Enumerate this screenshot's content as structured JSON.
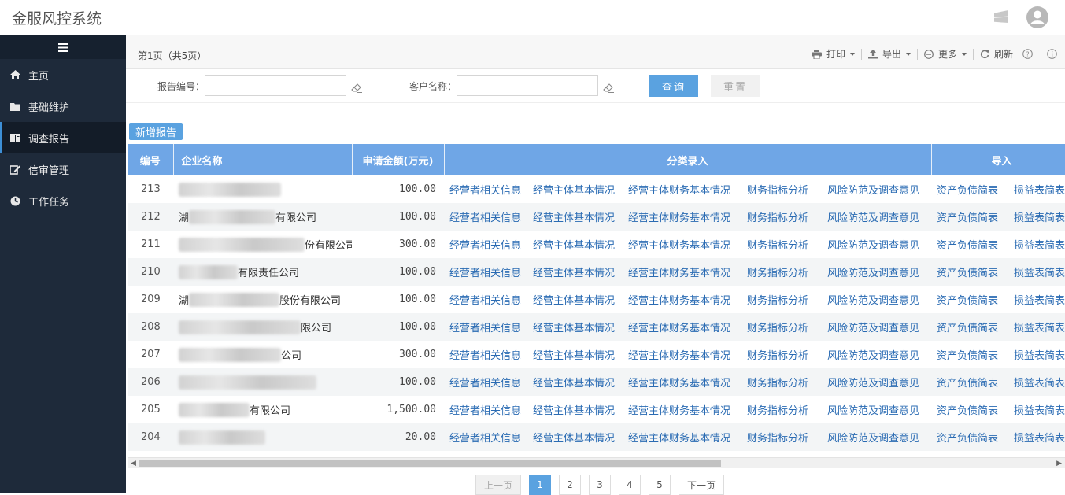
{
  "header": {
    "title": "金服风控系统"
  },
  "sidebar": {
    "toggle": "≡",
    "items": [
      {
        "label": "主页",
        "icon": "home-icon"
      },
      {
        "label": "基础维护",
        "icon": "folder-icon"
      },
      {
        "label": "调查报告",
        "icon": "book-icon",
        "active": true
      },
      {
        "label": "信审管理",
        "icon": "edit-icon"
      },
      {
        "label": "工作任务",
        "icon": "clock-icon"
      }
    ]
  },
  "toolbar": {
    "page_info": "第1页（共5页）",
    "print": "打印",
    "export": "导出",
    "more": "更多",
    "refresh": "刷新"
  },
  "search": {
    "report_no_label": "报告编号：",
    "customer_label": "客户名称：",
    "query": "查询",
    "reset": "重置"
  },
  "add_button": "新增报告",
  "table": {
    "headers": {
      "num": "编号",
      "name": "企业名称",
      "amount": "申请金额(万元)",
      "classify": "分类录入",
      "import": "导入"
    },
    "links": [
      "经营者相关信息",
      "经营主体基本情况",
      "经营主体财务基本情况",
      "财务指标分析",
      "风险防范及调查意见",
      "资产负债简表",
      "损益表简表"
    ],
    "rows": [
      {
        "num": "213",
        "prefix": "",
        "suffix": "",
        "amount": "100.00"
      },
      {
        "num": "212",
        "prefix": "湖",
        "suffix": "有限公司",
        "amount": "100.00"
      },
      {
        "num": "211",
        "prefix": "",
        "suffix": "份有限公司",
        "amount": "300.00"
      },
      {
        "num": "210",
        "prefix": "",
        "suffix": "有限责任公司",
        "amount": "100.00"
      },
      {
        "num": "209",
        "prefix": "湖",
        "suffix": "股份有限公司",
        "amount": "100.00"
      },
      {
        "num": "208",
        "prefix": "",
        "suffix": "限公司",
        "amount": "100.00"
      },
      {
        "num": "207",
        "prefix": "",
        "suffix": "公司",
        "amount": "300.00"
      },
      {
        "num": "206",
        "prefix": "",
        "suffix": "",
        "amount": "100.00"
      },
      {
        "num": "205",
        "prefix": "",
        "suffix": "有限公司",
        "amount": "1,500.00"
      },
      {
        "num": "204",
        "prefix": "",
        "suffix": "",
        "amount": "20.00"
      }
    ]
  },
  "pagination": {
    "prev": "上一页",
    "pages": [
      "1",
      "2",
      "3",
      "4",
      "5"
    ],
    "current": "1",
    "next": "下一页"
  }
}
